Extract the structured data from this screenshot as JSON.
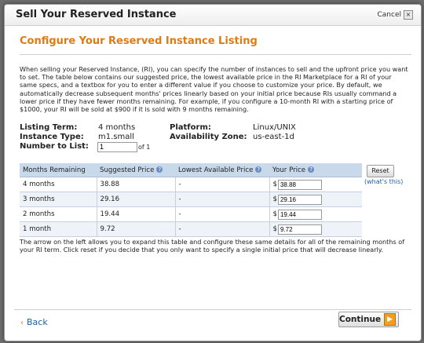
{
  "dialog": {
    "title": "Sell Your Reserved Instance",
    "cancel_label": "Cancel",
    "close_glyph": "×",
    "heading": "Configure Your Reserved Instance Listing",
    "intro": "When selling your Reserved Instance, (RI), you can specify the number of instances to sell and the upfront price you want to set. The table below contains our suggested price, the lowest available price in the RI Marketplace for a RI of your same specs, and a textbox for you to enter a different value if you choose to customize your price. By default, we automatically decrease subsequent months' prices linearly based on your initial price because RIs usually command a lower price if they have fewer months remaining. For example, if you configure a 10-month RI with a starting price of $1000, your RI will be sold at $900 if it is sold with 9 months remaining."
  },
  "meta": {
    "listing_term_label": "Listing Term:",
    "listing_term_value": "4 months",
    "instance_type_label": "Instance Type:",
    "instance_type_value": "m1.small",
    "number_label": "Number to List:",
    "number_value": "1",
    "number_of": "of 1",
    "platform_label": "Platform:",
    "platform_value": "Linux/UNIX",
    "az_label": "Availability Zone:",
    "az_value": "us-east-1d"
  },
  "table": {
    "headers": [
      "Months Remaining",
      "Suggested Price",
      "Lowest Available Price",
      "Your Price"
    ],
    "rows": [
      {
        "months": "4 months",
        "suggested": "38.88",
        "lowest": "-",
        "currency": "$",
        "your_price": "38.88"
      },
      {
        "months": "3 months",
        "suggested": "29.16",
        "lowest": "-",
        "currency": "$",
        "your_price": "29.16"
      },
      {
        "months": "2 months",
        "suggested": "19.44",
        "lowest": "-",
        "currency": "$",
        "your_price": "19.44"
      },
      {
        "months": "1 month",
        "suggested": "9.72",
        "lowest": "-",
        "currency": "$",
        "your_price": "9.72"
      }
    ]
  },
  "actions": {
    "reset_label": "Reset",
    "whats_this": "(what's this)",
    "back_label": "Back",
    "continue_label": "Continue"
  },
  "footer_text": "The arrow on the left allows you to expand this table and configure these same details for all of the remaining months of your RI term. Click reset if you decide that you only want to specify a single initial price that will decrease linearly.",
  "colors": {
    "accent": "#e07a12",
    "link": "#1c5fa8",
    "table_header": "#c9d9ec"
  }
}
